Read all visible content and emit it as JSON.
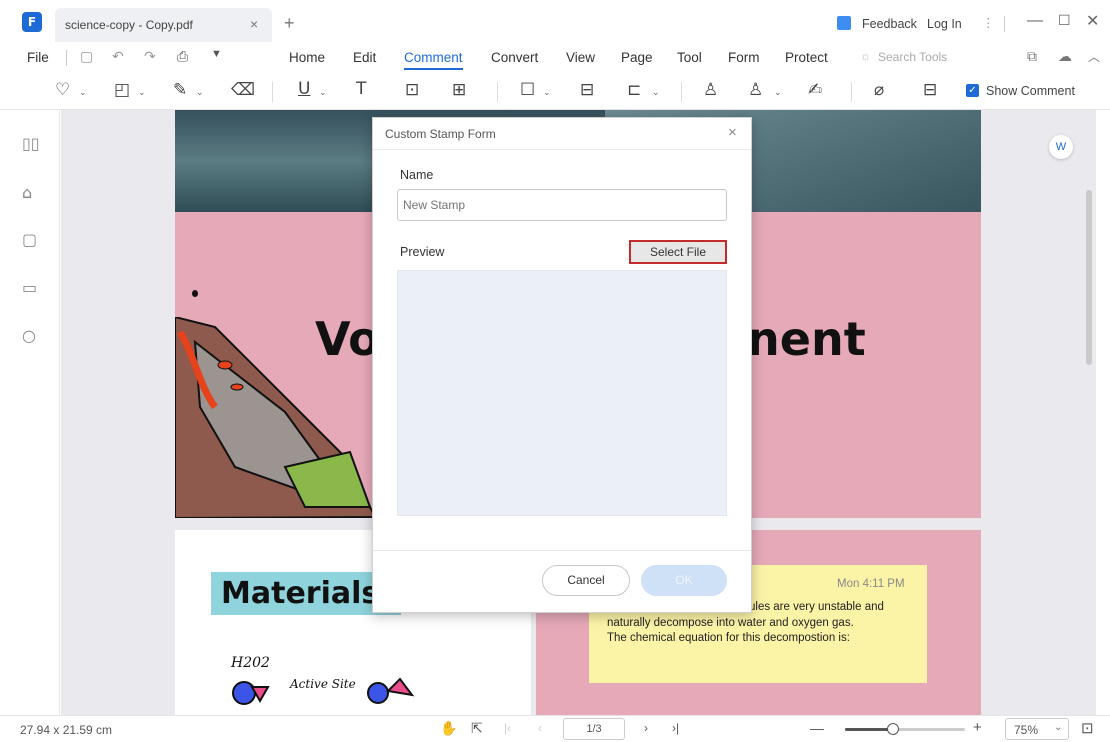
{
  "window": {
    "tab_title": "science-copy - Copy.pdf",
    "tab_close": "×",
    "new_tab": "+",
    "feedback": "Feedback",
    "login": "Log In"
  },
  "menu": {
    "file": "File",
    "items": [
      "Home",
      "Edit",
      "Comment",
      "Convert",
      "View",
      "Page",
      "Tool",
      "Form",
      "Protect"
    ],
    "active": "Comment",
    "search_placeholder": "Search Tools"
  },
  "toolbar": {
    "show_comment_label": "Show Comment",
    "show_comment_checked": true
  },
  "document": {
    "title_left": "Vo",
    "title_right": "nent",
    "materials_heading": "Materials:",
    "h2o2_label": "H202",
    "active_site_label": "Active Site",
    "note_time": "Mon 4:11 PM",
    "note_lines": [
      "ules are very unstable and",
      "naturally decompose into water and oxygen gas.",
      "The chemical equation for this decompostion is:"
    ]
  },
  "dialog": {
    "title": "Custom Stamp Form",
    "close": "×",
    "name_label": "Name",
    "name_placeholder": "New Stamp",
    "preview_label": "Preview",
    "select_file": "Select File",
    "cancel": "Cancel",
    "ok": "OK"
  },
  "status": {
    "page_size": "27.94 x 21.59 cm",
    "page_indicator": "1/3",
    "zoom": "75%",
    "zoom_level": 0.4
  },
  "colors": {
    "accent": "#1e6bd6",
    "highlight_border": "#c22c2c",
    "page_pink": "#e6a9b8",
    "note_yellow": "#fbf3a6"
  }
}
